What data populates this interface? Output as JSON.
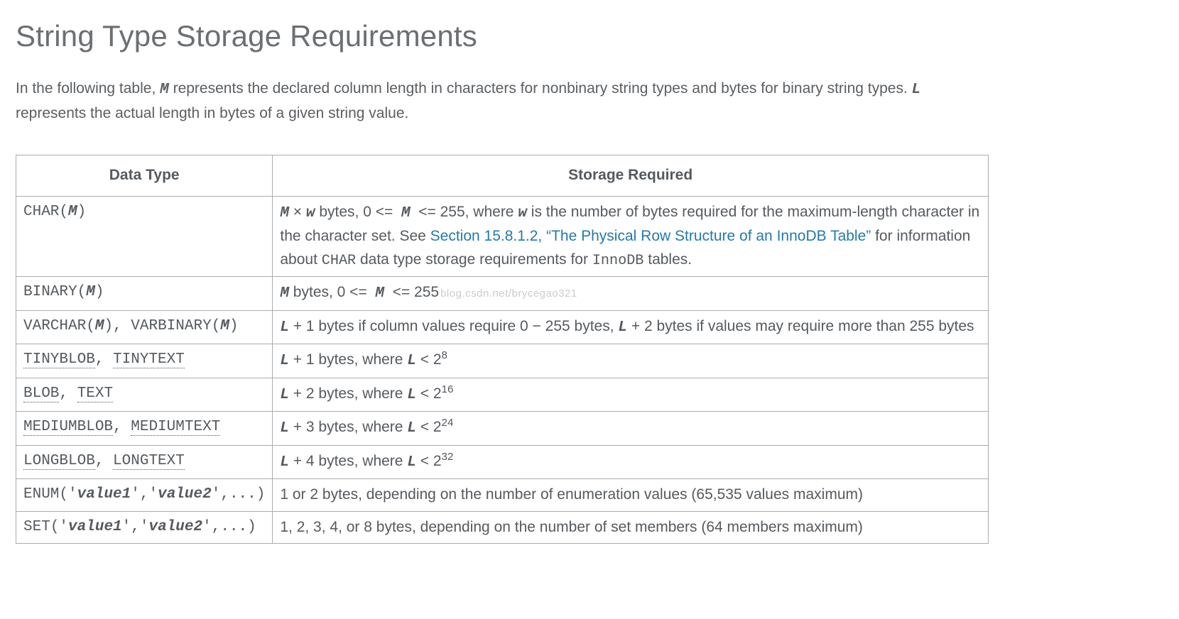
{
  "title": "String Type Storage Requirements",
  "intro_parts": {
    "a": "In the following table, ",
    "M": "M",
    "b": " represents the declared column length in characters for nonbinary string types and bytes for binary string types. ",
    "L": "L",
    "c": " represents the actual length in bytes of a given string value."
  },
  "headers": {
    "data_type": "Data Type",
    "storage_required": "Storage Required"
  },
  "link_text": "Section 15.8.1.2, “The Physical Row Structure of an InnoDB Table”",
  "watermark": "blog.csdn.net/brycegao321",
  "tokens": {
    "CHAR": "CHAR",
    "BINARY": "BINARY",
    "VARCHAR": "VARCHAR",
    "VARBINARY": "VARBINARY",
    "TINYBLOB": "TINYBLOB",
    "TINYTEXT": "TINYTEXT",
    "BLOB": "BLOB",
    "TEXT": "TEXT",
    "MEDIUMBLOB": "MEDIUMBLOB",
    "MEDIUMTEXT": "MEDIUMTEXT",
    "LONGBLOB": "LONGBLOB",
    "LONGTEXT": "LONGTEXT",
    "ENUM": "ENUM",
    "SET": "SET",
    "M": "M",
    "L": "L",
    "w": "w",
    "value1": "value1",
    "value2": "value2",
    "InnoDB": "InnoDB",
    "open_paren": "(",
    "close_paren": ")",
    "comma_sp": ", ",
    "comma": ",",
    "squote": "'",
    "dots": "..."
  },
  "rows": {
    "char": {
      "s1": " × ",
      "s2": " bytes, 0 <= ",
      "s3": " <= 255, where ",
      "s4": " is the number of bytes required for the maximum-length character in the character set. See ",
      "s5": " for information about ",
      "s6": " data type storage requirements for ",
      "s7": " tables."
    },
    "binary": {
      "s1": " bytes, 0 <= ",
      "s2": " <= 255"
    },
    "varchar": {
      "s1": " + 1 bytes if column values require 0 − 255 bytes, ",
      "s2": " + 2 bytes if values may require more than 255 bytes"
    },
    "tiny": {
      "s1": " + 1 bytes, where ",
      "s2": " < 2",
      "exp": "8"
    },
    "blob": {
      "s1": " + 2 bytes, where ",
      "s2": " < 2",
      "exp": "16"
    },
    "medium": {
      "s1": " + 3 bytes, where ",
      "s2": " < 2",
      "exp": "24"
    },
    "long": {
      "s1": " + 4 bytes, where ",
      "s2": " < 2",
      "exp": "32"
    },
    "enum": {
      "s": "1 or 2 bytes, depending on the number of enumeration values (65,535 values maximum)"
    },
    "set": {
      "s": "1, 2, 3, 4, or 8 bytes, depending on the number of set members (64 members maximum)"
    }
  }
}
